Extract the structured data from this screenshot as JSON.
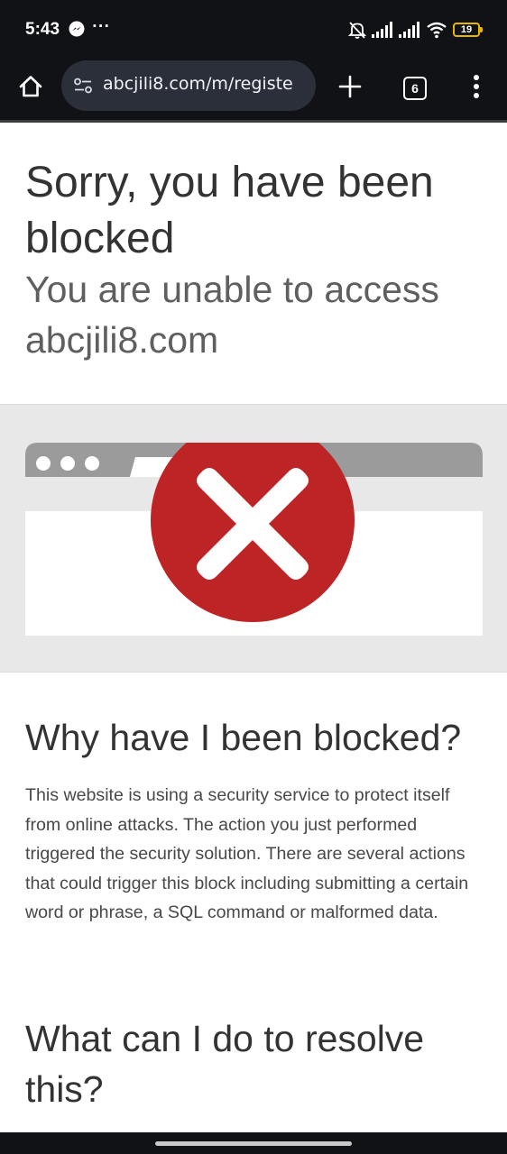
{
  "status_bar": {
    "time": "5:43",
    "dots": "···",
    "battery_level": "19",
    "icons": [
      "messenger-icon",
      "bell-off-icon",
      "signal-icon",
      "signal-icon",
      "wifi-icon",
      "battery-icon"
    ]
  },
  "browser": {
    "url": "abcjili8.com/m/registe",
    "tab_count": "6",
    "icons": [
      "home-icon",
      "site-info-icon",
      "plus-icon",
      "tabs-icon",
      "more-vert-icon"
    ]
  },
  "page": {
    "title": "Sorry, you have been blocked",
    "subtitle": "You are unable to access abcjili8.com",
    "why_heading": "Why have I been blocked?",
    "why_body": "This website is using a security service to protect itself from online attacks. The action you just performed triggered the security solution. There are several actions that could trigger this block including submitting a certain word or phrase, a SQL command or malformed data.",
    "resolve_heading": "What can I do to resolve this?"
  },
  "colors": {
    "system_bar": "#111216",
    "address_pill": "#2a2f3a",
    "error_red": "#bd2426",
    "illustration_gray": "#9b9b9b",
    "band_background": "#e8e8e8",
    "battery_outline": "#e4b800"
  }
}
